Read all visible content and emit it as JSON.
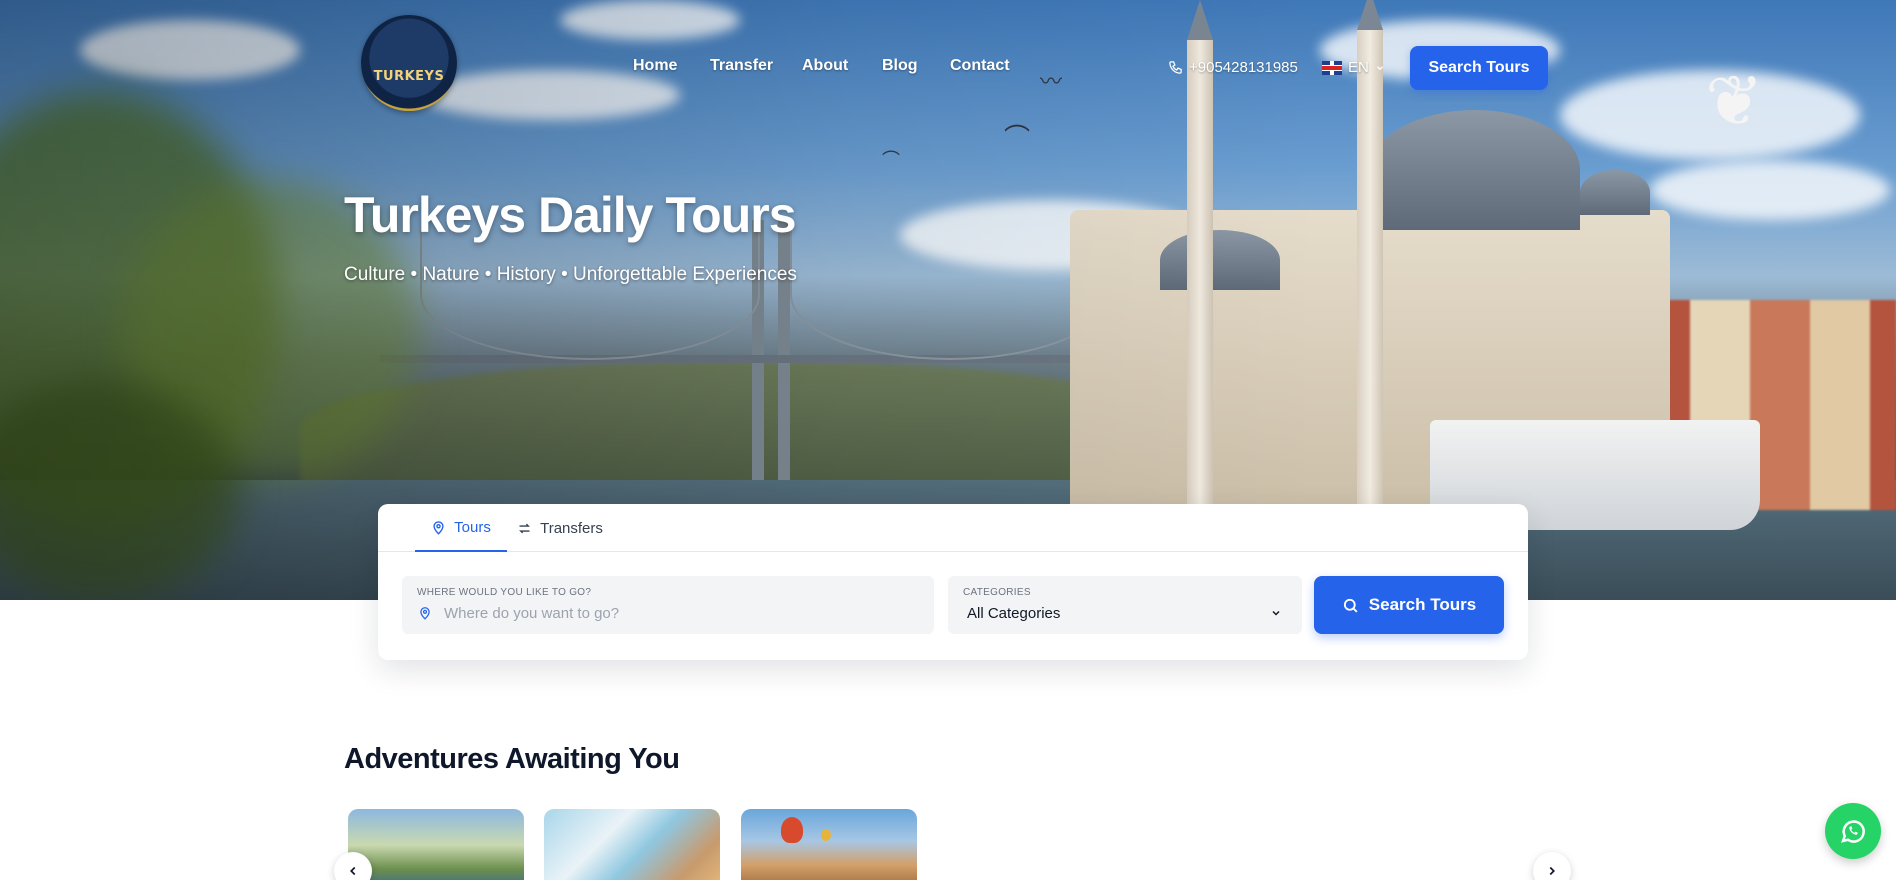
{
  "brand": {
    "logo_text": "TURKEYS"
  },
  "nav": {
    "links": [
      {
        "label": "Home"
      },
      {
        "label": "Transfer"
      },
      {
        "label": "About"
      },
      {
        "label": "Blog"
      },
      {
        "label": "Contact"
      }
    ]
  },
  "header": {
    "phone": "+905428131985",
    "language": "EN",
    "cta_label": "Search Tours"
  },
  "hero": {
    "title": "Turkeys Daily Tours",
    "subtitle": "Culture • Nature • History • Unforgettable Experiences"
  },
  "search": {
    "tabs": [
      {
        "label": "Tours",
        "icon": "map-pin-icon",
        "active": true
      },
      {
        "label": "Transfers",
        "icon": "swap-icon",
        "active": false
      }
    ],
    "destination": {
      "label": "WHERE WOULD YOU LIKE TO GO?",
      "placeholder": "Where do you want to go?"
    },
    "category": {
      "label": "CATEGORIES",
      "selected": "All Categories"
    },
    "button_label": "Search Tours"
  },
  "adventures": {
    "title": "Adventures Awaiting You"
  },
  "colors": {
    "accent": "#2563eb",
    "whatsapp": "#25d366",
    "heading": "#0f172a"
  }
}
